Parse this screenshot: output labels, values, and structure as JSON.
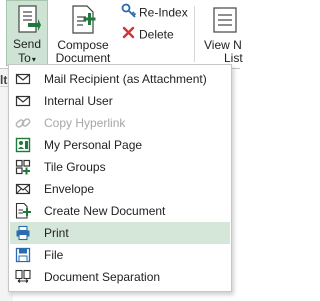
{
  "ribbon": {
    "send_to": {
      "line1": "Send",
      "line2": "To",
      "caret": "▾"
    },
    "compose": {
      "line1": "Compose",
      "line2": "Document"
    },
    "reindex": "Re-Index",
    "delete": "Delete",
    "view": {
      "line1": "View N",
      "line2": "List"
    }
  },
  "background_fragment": "lt",
  "menu": {
    "items": [
      {
        "label": "Mail Recipient (as Attachment)",
        "icon": "mail-icon",
        "disabled": false,
        "highlighted": false
      },
      {
        "label": "Internal User",
        "icon": "envelope-icon",
        "disabled": false,
        "highlighted": false
      },
      {
        "label": "Copy Hyperlink",
        "icon": "link-icon",
        "disabled": true,
        "highlighted": false
      },
      {
        "label": "My Personal Page",
        "icon": "personal-page-icon",
        "disabled": false,
        "highlighted": false
      },
      {
        "label": "Tile Groups",
        "icon": "tile-groups-icon",
        "disabled": false,
        "highlighted": false
      },
      {
        "label": "Envelope",
        "icon": "envelope-icon",
        "disabled": false,
        "highlighted": false
      },
      {
        "label": "Create New Document",
        "icon": "new-document-icon",
        "disabled": false,
        "highlighted": false
      },
      {
        "label": "Print",
        "icon": "printer-icon",
        "disabled": false,
        "highlighted": true
      },
      {
        "label": "File",
        "icon": "save-file-icon",
        "disabled": false,
        "highlighted": false
      },
      {
        "label": "Document Separation",
        "icon": "document-separation-icon",
        "disabled": false,
        "highlighted": false
      }
    ]
  },
  "colors": {
    "accent_green": "#1e7a3a",
    "highlight": "#d5e7d9",
    "delete_red": "#d13438",
    "icon_blue": "#2b6cb0"
  }
}
